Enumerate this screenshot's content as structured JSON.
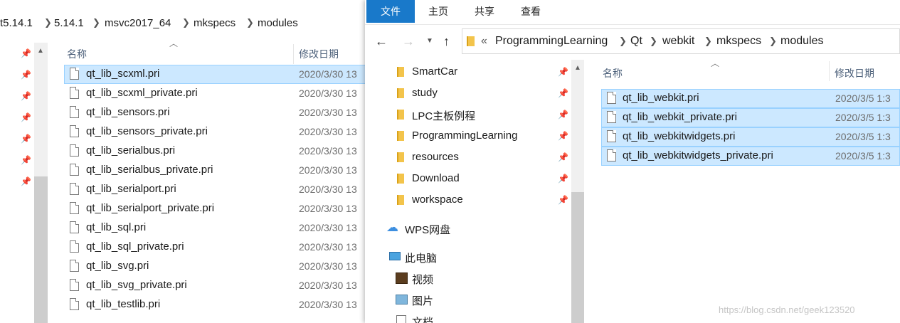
{
  "left_window": {
    "breadcrumbs": [
      "t5.14.1",
      "5.14.1",
      "msvc2017_64",
      "mkspecs",
      "modules"
    ],
    "header": {
      "name": "名称",
      "date": "修改日期"
    },
    "files": [
      {
        "name": "qt_lib_scxml.pri",
        "date": "2020/3/30 13"
      },
      {
        "name": "qt_lib_scxml_private.pri",
        "date": "2020/3/30 13"
      },
      {
        "name": "qt_lib_sensors.pri",
        "date": "2020/3/30 13"
      },
      {
        "name": "qt_lib_sensors_private.pri",
        "date": "2020/3/30 13"
      },
      {
        "name": "qt_lib_serialbus.pri",
        "date": "2020/3/30 13"
      },
      {
        "name": "qt_lib_serialbus_private.pri",
        "date": "2020/3/30 13"
      },
      {
        "name": "qt_lib_serialport.pri",
        "date": "2020/3/30 13"
      },
      {
        "name": "qt_lib_serialport_private.pri",
        "date": "2020/3/30 13"
      },
      {
        "name": "qt_lib_sql.pri",
        "date": "2020/3/30 13"
      },
      {
        "name": "qt_lib_sql_private.pri",
        "date": "2020/3/30 13"
      },
      {
        "name": "qt_lib_svg.pri",
        "date": "2020/3/30 13"
      },
      {
        "name": "qt_lib_svg_private.pri",
        "date": "2020/3/30 13"
      },
      {
        "name": "qt_lib_testlib.pri",
        "date": "2020/3/30 13"
      }
    ]
  },
  "right_window": {
    "ribbon_tabs": [
      "文件",
      "主页",
      "共享",
      "查看"
    ],
    "address": {
      "overflow": "«",
      "breadcrumbs": [
        "ProgrammingLearning",
        "Qt",
        "webkit",
        "mkspecs",
        "modules"
      ]
    },
    "nav_items": [
      {
        "label": "SmartCar",
        "pinned": true
      },
      {
        "label": "study",
        "pinned": true
      },
      {
        "label": "LPC主板例程",
        "pinned": true
      },
      {
        "label": "ProgrammingLearning",
        "pinned": true
      },
      {
        "label": "resources",
        "pinned": true
      },
      {
        "label": "Download",
        "pinned": true
      },
      {
        "label": "workspace",
        "pinned": true
      }
    ],
    "wps_label": "WPS网盘",
    "this_pc_label": "此电脑",
    "pc_children": [
      "视频",
      "图片",
      "文档"
    ],
    "header": {
      "name": "名称",
      "date": "修改日期"
    },
    "files": [
      {
        "name": "qt_lib_webkit.pri",
        "date": "2020/3/5 1:3"
      },
      {
        "name": "qt_lib_webkit_private.pri",
        "date": "2020/3/5 1:3"
      },
      {
        "name": "qt_lib_webkitwidgets.pri",
        "date": "2020/3/5 1:3"
      },
      {
        "name": "qt_lib_webkitwidgets_private.pri",
        "date": "2020/3/5 1:3"
      }
    ]
  },
  "watermark": "https://blog.csdn.net/geek123520",
  "colors": {
    "selection": "#cce8ff",
    "accent": "#1979ca",
    "folder": "#f3c44b"
  }
}
